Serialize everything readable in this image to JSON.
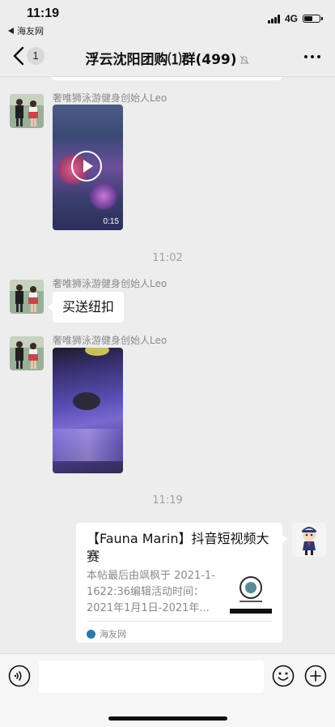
{
  "status_bar": {
    "time": "11:19",
    "back_app": "海友网",
    "network": "4G",
    "battery_level": 0.6
  },
  "nav": {
    "unread_badge": "1",
    "title": "浮云沈阳团购⑴群(499)",
    "back_icon": "chevron-left-icon",
    "mute_icon": "bell-off-icon",
    "more_icon": "more-dots-icon"
  },
  "messages": [
    {
      "sender": "奢唯狮泳游健身创始人Leo",
      "type": "video",
      "duration": "0:15"
    },
    {
      "timestamp": "11:02"
    },
    {
      "sender": "奢唯狮泳游健身创始人Leo",
      "type": "text",
      "text": "买送纽扣"
    },
    {
      "sender": "奢唯狮泳游健身创始人Leo",
      "type": "image"
    },
    {
      "timestamp": "11:19"
    },
    {
      "type": "link",
      "title": "【Fauna Marin】抖音短视频大赛",
      "description": "本帖最后由飒枫于 2021-1-1622:36编辑活动时间：2021年1月1日-2021年...",
      "source": "海友网"
    }
  ],
  "input_bar": {
    "voice_icon": "voice-icon",
    "emoji_icon": "emoji-icon",
    "plus_icon": "plus-icon"
  }
}
